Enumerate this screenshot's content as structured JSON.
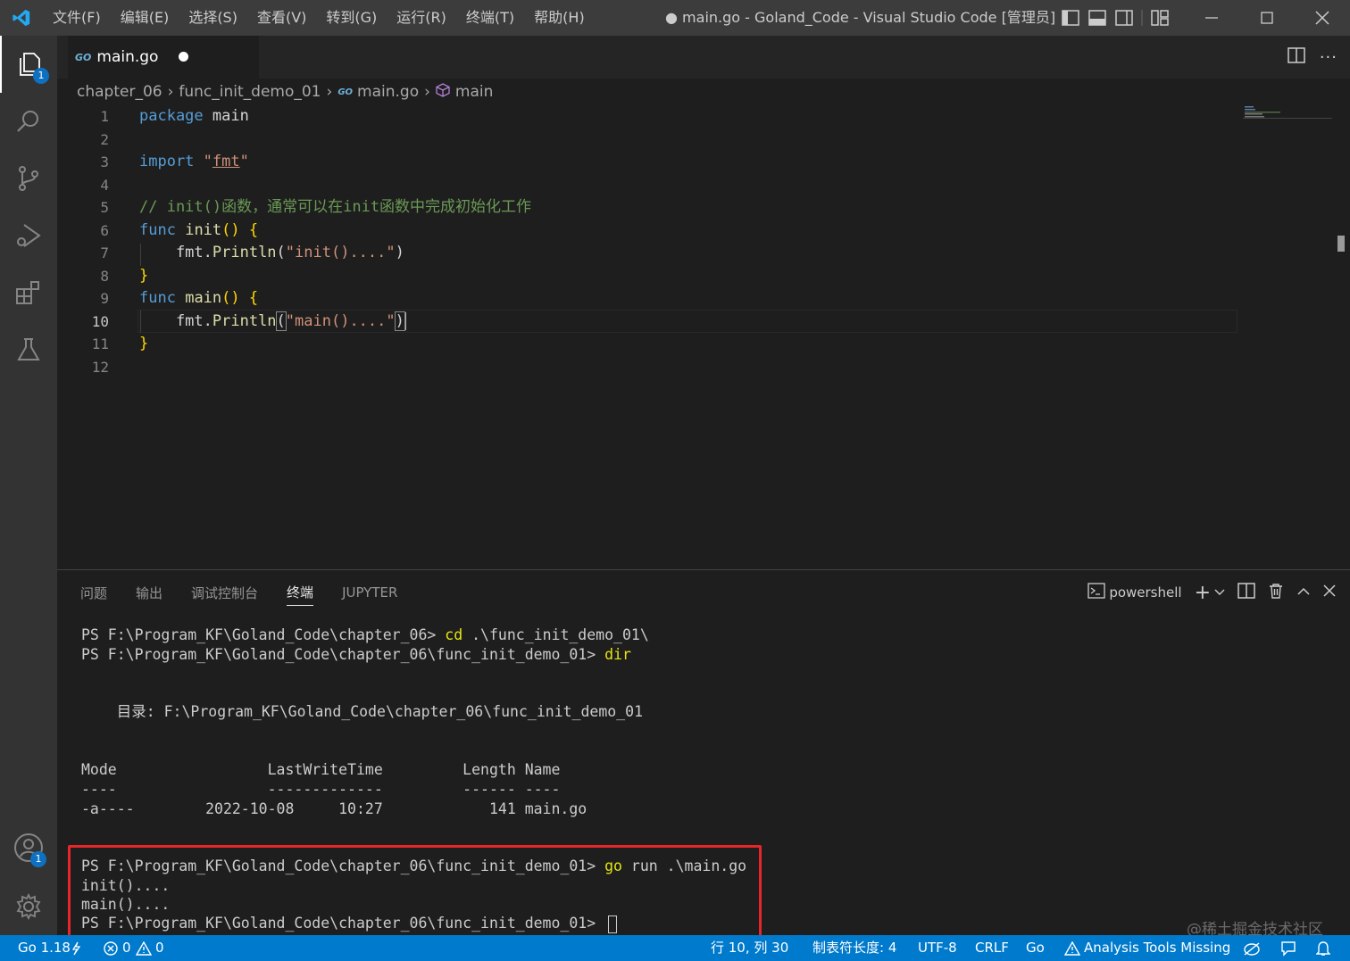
{
  "window": {
    "title": "● main.go - Goland_Code - Visual Studio Code [管理员]",
    "menu": [
      "文件(F)",
      "编辑(E)",
      "选择(S)",
      "查看(V)",
      "转到(G)",
      "运行(R)",
      "终端(T)",
      "帮助(H)"
    ]
  },
  "activity": {
    "explorer_badge": "1",
    "accounts_badge": "1"
  },
  "tab": {
    "label": "main.go",
    "icon_text": "GO"
  },
  "breadcrumb": {
    "items": [
      "chapter_06",
      "func_init_demo_01",
      "main.go",
      "main"
    ]
  },
  "editor": {
    "line_numbers": [
      "1",
      "2",
      "3",
      "4",
      "5",
      "6",
      "7",
      "8",
      "9",
      "10",
      "11",
      "12"
    ],
    "active_line": 10
  },
  "panel": {
    "tabs": [
      "问题",
      "输出",
      "调试控制台",
      "终端",
      "JUPYTER"
    ],
    "active_tab": "终端",
    "shell_label": "powershell"
  },
  "terminal": {
    "prompt1": "PS F:\\Program_KF\\Goland_Code\\chapter_06> ",
    "cmd1": "cd",
    "arg1": " .\\func_init_demo_01\\",
    "prompt2": "PS F:\\Program_KF\\Goland_Code\\chapter_06\\func_init_demo_01> ",
    "cmd2": "dir",
    "dir_line": "    目录: F:\\Program_KF\\Goland_Code\\chapter_06\\func_init_demo_01",
    "header_line": "Mode                 LastWriteTime         Length Name",
    "dash_line": "----                 -------------         ------ ----",
    "row_line": "-a----        2022-10-08     10:27            141 main.go",
    "prompt3": "PS F:\\Program_KF\\Goland_Code\\chapter_06\\func_init_demo_01> ",
    "cmd3": "go",
    "arg3": " run .\\main.go",
    "out1": "init()....",
    "out2": "main()....",
    "prompt4": "PS F:\\Program_KF\\Goland_Code\\chapter_06\\func_init_demo_01> ",
    "watermark": "@稀土掘金技术社区"
  },
  "status": {
    "go_version": "Go 1.18",
    "errors": "0",
    "warnings": "0",
    "position": "行 10, 列 30",
    "tab_size": "制表符长度: 4",
    "encoding": "UTF-8",
    "eol": "CRLF",
    "language": "Go",
    "analysis": "Analysis Tools Missing"
  },
  "colors": {
    "statusbar": "#007acc",
    "highlight_box": "#e8262a",
    "keyword": "#569cd6",
    "string": "#ce9178",
    "comment": "#6a9955"
  }
}
